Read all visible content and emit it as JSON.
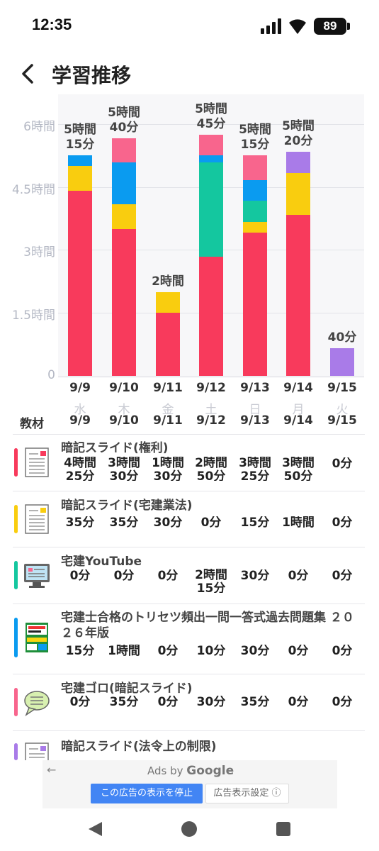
{
  "status_bar": {
    "time": "12:35",
    "battery": "89"
  },
  "header": {
    "title": "学習推移"
  },
  "colors": {
    "red": "#f83a5c",
    "yellow": "#f9cd0f",
    "teal": "#14c79f",
    "blue": "#0a9bf0",
    "pink": "#f8658d",
    "purple": "#a97be8"
  },
  "chart_data": {
    "type": "bar",
    "stacked": true,
    "y_unit": "minutes",
    "ylim": [
      0,
      420
    ],
    "y_ticks": [
      {
        "value": 0,
        "label": "0"
      },
      {
        "value": 90,
        "label": "1.5時間"
      },
      {
        "value": 180,
        "label": "3時間"
      },
      {
        "value": 270,
        "label": "4.5時間"
      },
      {
        "value": 360,
        "label": "6時間"
      }
    ],
    "categories": [
      "9/9",
      "9/10",
      "9/11",
      "9/12",
      "9/13",
      "9/14",
      "9/15"
    ],
    "weekdays": [
      "水",
      "木",
      "金",
      "土",
      "日",
      "月",
      "火"
    ],
    "totals_labels": [
      [
        "5時間",
        "15分"
      ],
      [
        "5時間",
        "40分"
      ],
      [
        "2時間"
      ],
      [
        "5時間",
        "45分"
      ],
      [
        "5時間",
        "15分"
      ],
      [
        "5時間",
        "20分"
      ],
      [
        "40分"
      ]
    ],
    "series": [
      {
        "color": "#f83a5c",
        "values": [
          265,
          210,
          90,
          170,
          205,
          230,
          0
        ]
      },
      {
        "color": "#f9cd0f",
        "values": [
          35,
          35,
          30,
          0,
          15,
          60,
          0
        ]
      },
      {
        "color": "#14c79f",
        "values": [
          0,
          0,
          0,
          135,
          30,
          0,
          0
        ]
      },
      {
        "color": "#0a9bf0",
        "values": [
          15,
          60,
          0,
          10,
          30,
          0,
          0
        ]
      },
      {
        "color": "#f8658d",
        "values": [
          0,
          35,
          0,
          30,
          35,
          0,
          0
        ]
      },
      {
        "color": "#a97be8",
        "values": [
          0,
          0,
          0,
          0,
          0,
          30,
          40
        ]
      }
    ]
  },
  "table": {
    "header_label": "教材",
    "dates": [
      "9/9",
      "9/10",
      "9/11",
      "9/12",
      "9/13",
      "9/14",
      "9/15"
    ],
    "rows": [
      {
        "title": "暗記スライド(権利)",
        "color": "#f83a5c",
        "icon": "document-icon",
        "cells": [
          [
            "4時間",
            "25分"
          ],
          [
            "3時間",
            "30分"
          ],
          [
            "1時間",
            "30分"
          ],
          [
            "2時間",
            "50分"
          ],
          [
            "3時間",
            "25分"
          ],
          [
            "3時間",
            "50分"
          ],
          [
            "0分"
          ]
        ]
      },
      {
        "title": "暗記スライド(宅建業法)",
        "color": "#f9cd0f",
        "icon": "document-icon",
        "cells": [
          [
            "35分"
          ],
          [
            "35分"
          ],
          [
            "30分"
          ],
          [
            "0分"
          ],
          [
            "15分"
          ],
          [
            "1時間"
          ],
          [
            "0分"
          ]
        ]
      },
      {
        "title": "宅建YouTube",
        "color": "#14c79f",
        "icon": "monitor-icon",
        "cells": [
          [
            "0分"
          ],
          [
            "0分"
          ],
          [
            "0分"
          ],
          [
            "2時間",
            "15分"
          ],
          [
            "30分"
          ],
          [
            "0分"
          ],
          [
            "0分"
          ]
        ]
      },
      {
        "title": "宅建士合格のトリセツ頻出一問一答式過去問題集 ２０２６年版",
        "color": "#0a9bf0",
        "icon": "book-cover-icon",
        "cells": [
          [
            "15分"
          ],
          [
            "1時間"
          ],
          [
            "0分"
          ],
          [
            "10分"
          ],
          [
            "30分"
          ],
          [
            "0分"
          ],
          [
            "0分"
          ]
        ]
      },
      {
        "title": "宅建ゴロ(暗記スライド)",
        "color": "#f8658d",
        "icon": "speech-bubble-icon",
        "cells": [
          [
            "0分"
          ],
          [
            "35分"
          ],
          [
            "0分"
          ],
          [
            "30分"
          ],
          [
            "35分"
          ],
          [
            "0分"
          ],
          [
            "0分"
          ]
        ]
      },
      {
        "title": "暗記スライド(法令上の制限)",
        "color": "#a97be8",
        "icon": "document-icon",
        "cells": []
      }
    ]
  },
  "ad": {
    "label": "Ads by",
    "brand": "Google",
    "stop_button": "この広告の表示を停止",
    "settings_button": "広告表示設定 ⓘ",
    "back_glyph": "←"
  }
}
